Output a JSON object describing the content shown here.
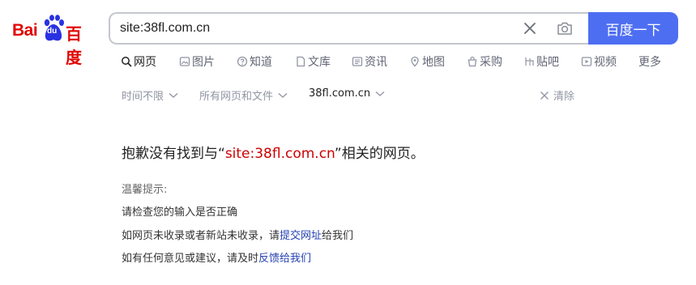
{
  "logo": {
    "part1": "Bai",
    "part2": "du",
    "part3": "百度"
  },
  "search": {
    "value": "site:38fl.com.cn",
    "button_label": "百度一下"
  },
  "tabs": [
    {
      "label": "网页",
      "icon": "search-icon",
      "active": true
    },
    {
      "label": "图片",
      "icon": "image-icon"
    },
    {
      "label": "知道",
      "icon": "question-icon"
    },
    {
      "label": "文库",
      "icon": "document-icon"
    },
    {
      "label": "资讯",
      "icon": "news-icon"
    },
    {
      "label": "地图",
      "icon": "map-icon"
    },
    {
      "label": "采购",
      "icon": "shopping-icon"
    },
    {
      "label": "贴吧",
      "icon": "tieba-icon"
    },
    {
      "label": "视频",
      "icon": "video-icon"
    },
    {
      "label": "更多"
    }
  ],
  "filters": {
    "time": "时间不限",
    "type": "所有网页和文件",
    "site": "38fl.com.cn",
    "clear": "清除"
  },
  "result": {
    "prefix": "抱歉没有找到与",
    "open_quote": "“",
    "query": "site:38fl.com.cn",
    "close_quote": "”",
    "suffix": "相关的网页。"
  },
  "tips": {
    "title": "温馨提示:",
    "line1": "请检查您的输入是否正确",
    "line2_prefix": "如网页未收录或者新站未收录，请",
    "line2_link": "提交网址",
    "line2_suffix": "给我们",
    "line3_prefix": "如有任何意见或建议，请及时",
    "line3_link": "反馈给我们"
  },
  "colors": {
    "brand_red": "#e10602",
    "search_blue": "#4e6ef2",
    "link_blue": "#2440b3",
    "query_red": "#cc0000"
  }
}
